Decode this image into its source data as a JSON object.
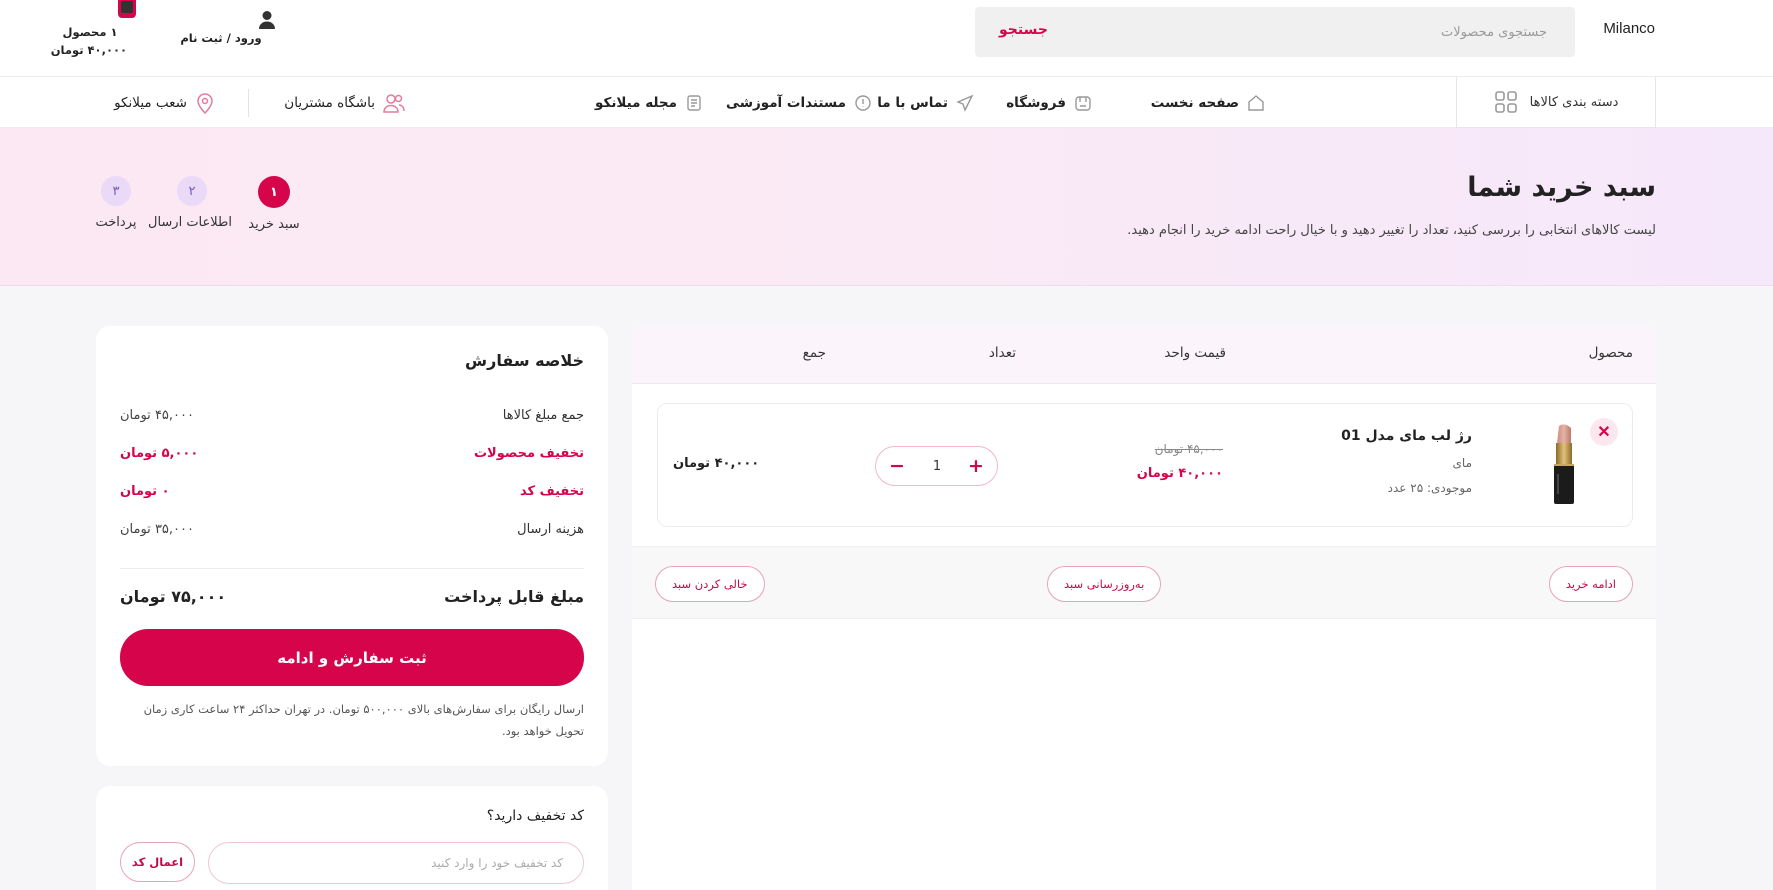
{
  "header": {
    "brand": "Milanco",
    "search_placeholder": "جستجوی محصولات",
    "search_button": "جستجو",
    "account_label": "ورود / ثبت نام",
    "cart_count": "۱ محصول",
    "cart_total": "۴۰,۰۰۰ تومان"
  },
  "nav": {
    "categories": "دسته بندی کالاها",
    "home": "صفحه نخست",
    "shop": "فروشگاه",
    "contact": "تماس با ما",
    "docs": "مستندات آموزشی",
    "magazine": "مجله میلانکو",
    "club": "باشگاه مشتریان",
    "branches": "شعب میلانکو"
  },
  "hero": {
    "title": "سبد خرید شما",
    "subtitle": "لیست کالاهای انتخابی را بررسی کنید، تعداد را تغییر دهید و با خیال راحت ادامه خرید را انجام دهید.",
    "steps": [
      {
        "num": "۱",
        "label": "سبد خرید"
      },
      {
        "num": "۲",
        "label": "اطلاعات ارسال"
      },
      {
        "num": "۳",
        "label": "پرداخت"
      }
    ],
    "active_step": 1
  },
  "cart": {
    "columns": {
      "product": "محصول",
      "unit_price": "قیمت واحد",
      "qty": "تعداد",
      "total": "جمع"
    },
    "item": {
      "remove": "✕",
      "name": "رژ لب مای مدل 01",
      "brand": "مای",
      "stock": "موجودی: ۲۵ عدد",
      "price_old": "۴۵,۰۰۰ تومان",
      "price_new": "۴۰,۰۰۰ تومان",
      "quantity": "1",
      "plus": "+",
      "minus": "−",
      "line_total": "۴۰,۰۰۰ تومان"
    },
    "actions": {
      "continue": "ادامه خرید",
      "update": "به‌روزرسانی سبد",
      "empty": "خالی کردن سبد"
    }
  },
  "summary": {
    "title": "خلاصه سفارش",
    "rows": [
      {
        "label": "جمع مبلغ کالاها",
        "value": "۴۵,۰۰۰ تومان"
      },
      {
        "label": "تخفیف محصولات",
        "value": "۵,۰۰۰ تومان"
      },
      {
        "label": "تخفیف کد",
        "value": "۰ تومان"
      },
      {
        "label": "هزینه ارسال",
        "value": "۳۵,۰۰۰ تومان"
      }
    ],
    "payable_label": "مبلغ قابل پرداخت",
    "payable_value": "۷۵,۰۰۰ تومان",
    "checkout": "ثبت سفارش و ادامه",
    "note": "ارسال رایگان برای سفارش‌های بالای ۵۰۰,۰۰۰ تومان. در تهران حداکثر ۲۴ ساعت کاری زمان تحویل خواهد بود."
  },
  "coupon": {
    "title": "کد تخفیف دارید؟",
    "placeholder": "کد تخفیف خود را وارد کنید",
    "apply": "اعمال کد"
  },
  "colors": {
    "accent": "#d6044b",
    "step_inactive_bg": "#ead9f7",
    "hero_bg": "#fbe8f3"
  }
}
